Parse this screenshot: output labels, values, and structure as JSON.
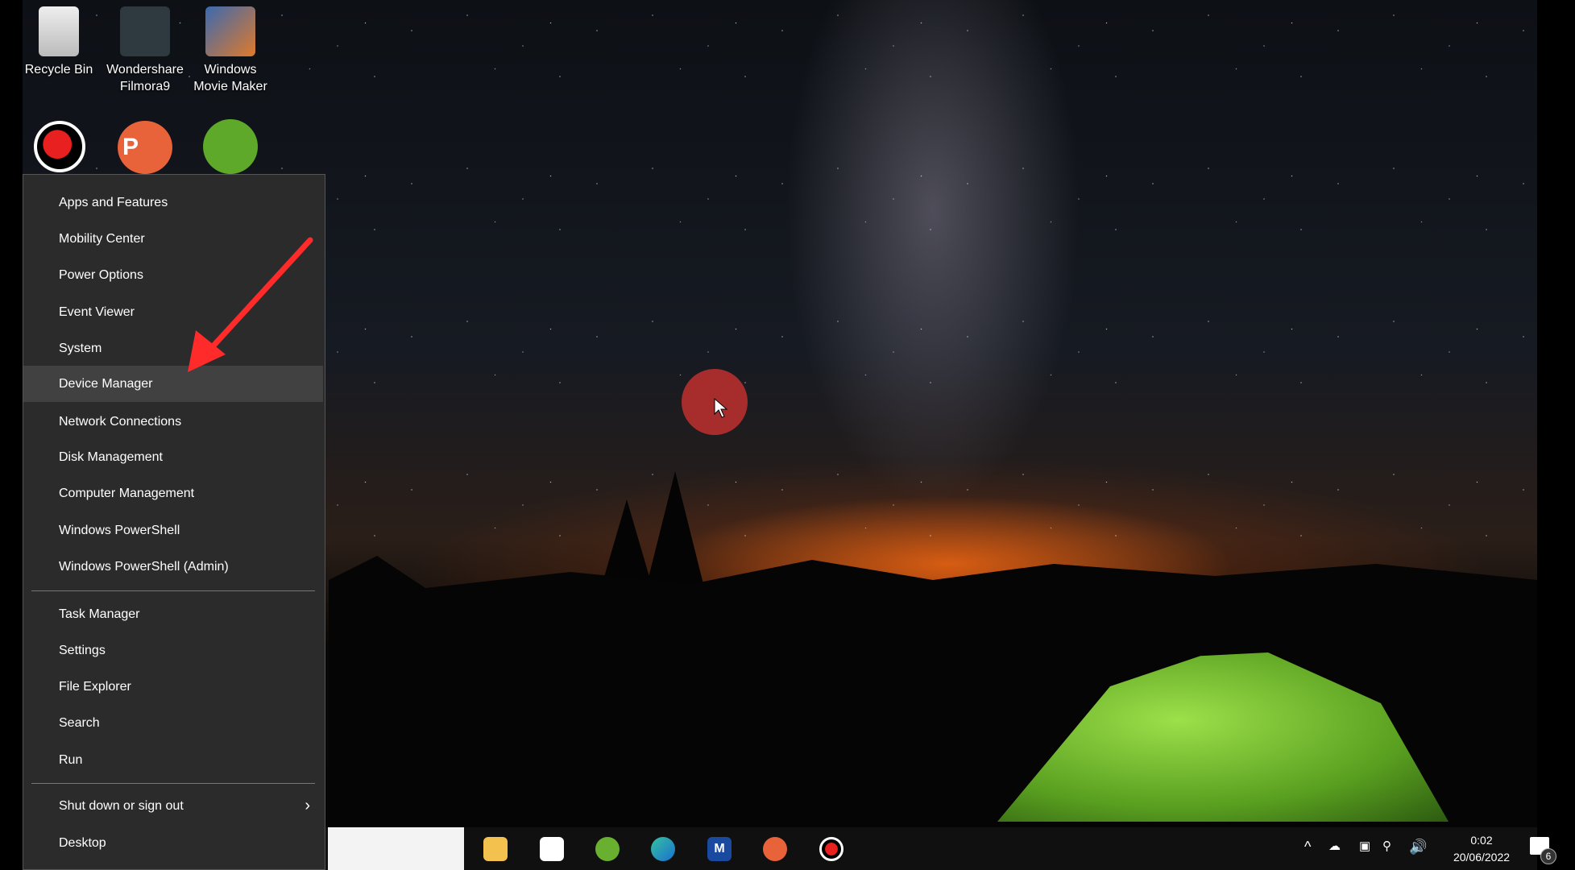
{
  "desktop": {
    "icons": [
      {
        "label": "Recycle Bin",
        "icon": "recycle-bin-icon"
      },
      {
        "label": "Wondershare Filmora9",
        "icon": "filmora-icon"
      },
      {
        "label": "Windows Movie Maker",
        "icon": "movie-maker-icon"
      },
      {
        "label": "",
        "icon": "screen-recorder-icon"
      },
      {
        "label": "",
        "icon": "powerpoint-icon"
      },
      {
        "label": "",
        "icon": "coreldraw-icon"
      }
    ]
  },
  "menu": {
    "items": [
      "Apps and Features",
      "Mobility Center",
      "Power Options",
      "Event Viewer",
      "System",
      "Device Manager",
      "Network Connections",
      "Disk Management",
      "Computer Management",
      "Windows PowerShell",
      "Windows PowerShell (Admin)",
      "Task Manager",
      "Settings",
      "File Explorer",
      "Search",
      "Run",
      "Shut down or sign out",
      "Desktop"
    ],
    "highlighted": "Device Manager"
  },
  "taskbar": {
    "apps": [
      "file-explorer-icon",
      "microsoft-store-icon",
      "coreldraw-icon",
      "edge-icon",
      "app-m-icon",
      "powerpoint-icon",
      "recorder-icon"
    ],
    "time": "0:02",
    "date": "20/06/2022",
    "notifications": "6"
  },
  "colors": {
    "arrow": "#ff2a2a",
    "cursor_highlight": "#c0302f"
  }
}
